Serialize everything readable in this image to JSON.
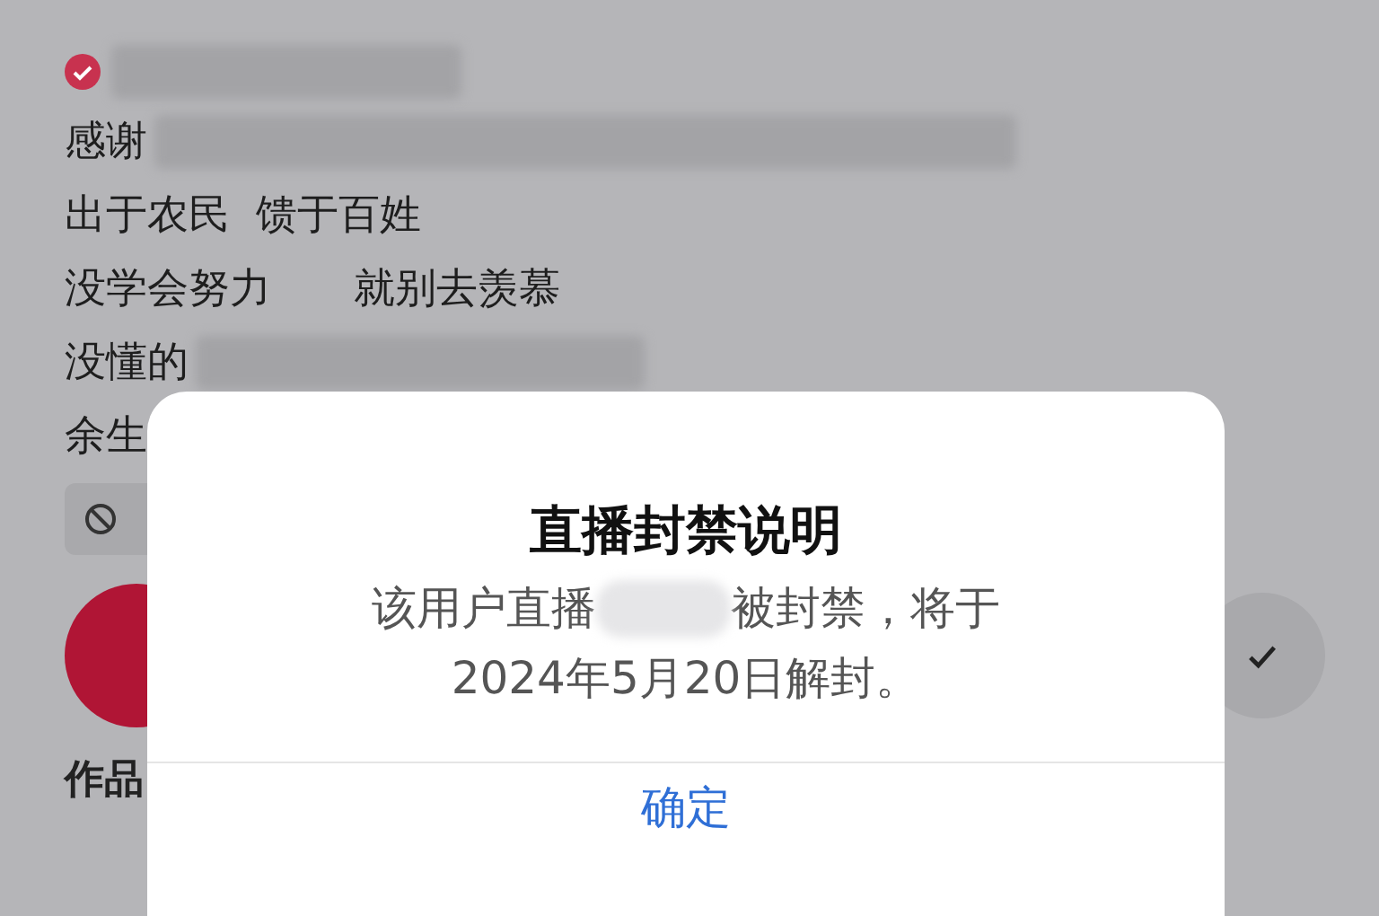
{
  "profile": {
    "verified": true,
    "bio_lines": [
      {
        "text": "感谢",
        "redacted": true
      },
      {
        "text": "出于农民  馈于百姓",
        "redacted": false
      },
      {
        "text": "没学会努力　　就别去羡慕",
        "redacted": false
      },
      {
        "text": "没懂的",
        "redacted": true
      },
      {
        "text": "余生",
        "redacted": false
      }
    ],
    "tabs": [
      {
        "label": "作品"
      }
    ]
  },
  "dialog": {
    "title": "直播封禁说明",
    "message_start": "该用户直播",
    "message_end": "被封禁，将于",
    "message_line2": "2024年5月20日解封。",
    "button": "确定"
  }
}
